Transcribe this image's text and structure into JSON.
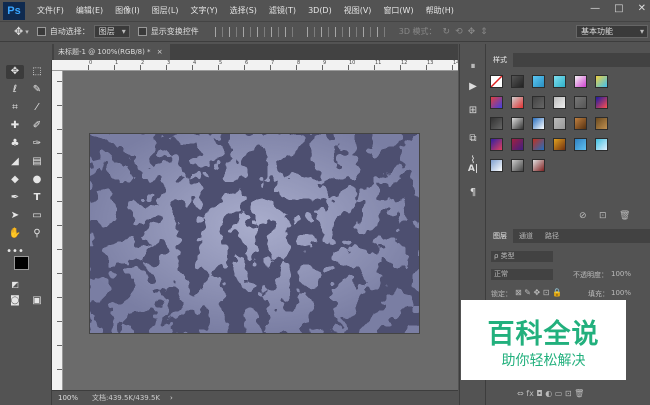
{
  "app": {
    "logo": "Ps"
  },
  "menu": [
    "文件(F)",
    "编辑(E)",
    "图像(I)",
    "图层(L)",
    "文字(Y)",
    "选择(S)",
    "滤镜(T)",
    "3D(D)",
    "视图(V)",
    "窗口(W)",
    "帮助(H)"
  ],
  "window_controls": {
    "minimize": "—",
    "maximize": "□",
    "close": "✕"
  },
  "options_bar": {
    "auto_select_label": "自动选择：",
    "auto_select_value": "图层",
    "show_transform_label": "显示变换控件",
    "mode_3d_label": "3D 模式：",
    "workspace_value": "基本功能"
  },
  "document": {
    "tab_label": "未标题-1 @ 100%(RGB/8) *",
    "tab_close": "×"
  },
  "ruler_top_labels": [
    "0",
    "1",
    "2",
    "3",
    "4",
    "5",
    "6",
    "7",
    "8",
    "9",
    "10",
    "11",
    "12",
    "13",
    "14"
  ],
  "status": {
    "zoom": "100%",
    "doc_info": "文档:439.5K/439.5K",
    "arrow": "›"
  },
  "styles_panel": {
    "tab": "样式"
  },
  "layers_panel": {
    "tabs": [
      "图层",
      "通道",
      "路径"
    ],
    "filter_label": "ρ 类型",
    "blend_mode": "正常",
    "opacity_label": "不透明度：",
    "opacity_value": "100%",
    "lock_label": "锁定：",
    "fill_label": "填充：",
    "fill_value": "100%"
  },
  "watermark": {
    "title": "百科全说",
    "subtitle": "助你轻松解决"
  },
  "colors": {
    "canvas_base": "#7e82a8",
    "canvas_dark": "#4d5070",
    "watermark_green": "#22b07d",
    "foreground": "#000000",
    "background": "#ffffff"
  }
}
